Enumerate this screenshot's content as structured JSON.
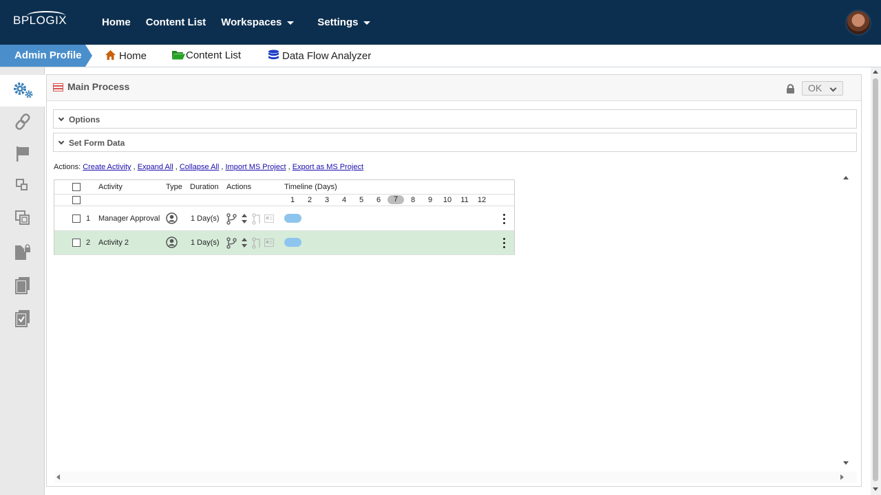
{
  "app": {
    "logo_text": "BPLOGIX"
  },
  "topnav": {
    "items": [
      {
        "label": "Home"
      },
      {
        "label": "Content List"
      },
      {
        "label": "Workspaces"
      },
      {
        "label": "Settings"
      }
    ]
  },
  "breadcrumb": {
    "admin": "Admin Profile",
    "items": [
      {
        "label": "Home",
        "icon": "house-icon"
      },
      {
        "label": "Content List",
        "icon": "folder-icon"
      },
      {
        "label": "Data Flow Analyzer",
        "icon": "database-icon"
      }
    ]
  },
  "sidebar": {
    "items": [
      {
        "icon": "gears-icon"
      },
      {
        "icon": "link-icon"
      },
      {
        "icon": "flag-icon"
      },
      {
        "icon": "layers-icon"
      },
      {
        "icon": "copy-icon"
      },
      {
        "icon": "locked-document-icon"
      },
      {
        "icon": "documents-icon"
      },
      {
        "icon": "checkbox-document-icon"
      }
    ]
  },
  "panel": {
    "title": "Main Process",
    "ok_label": "OK",
    "sections": [
      {
        "label": "Options"
      },
      {
        "label": "Set Form Data"
      }
    ],
    "actions_label": "Actions:",
    "actions": [
      {
        "label": "Create Activity"
      },
      {
        "label": "Expand All"
      },
      {
        "label": "Collapse All"
      },
      {
        "label": "Import MS Project"
      },
      {
        "label": "Export as MS Project"
      }
    ]
  },
  "grid": {
    "headers": {
      "activity": "Activity",
      "type": "Type",
      "duration": "Duration",
      "actions": "Actions",
      "timeline": "Timeline (Days)"
    },
    "days": [
      "1",
      "2",
      "3",
      "4",
      "5",
      "6",
      "7",
      "8",
      "9",
      "10",
      "11",
      "12"
    ],
    "today_index": 6,
    "rows": [
      {
        "num": "1",
        "activity": "Manager Approval",
        "duration": "1 Day(s)",
        "selected": false
      },
      {
        "num": "2",
        "activity": "Activity 2",
        "duration": "1 Day(s)",
        "selected": true
      }
    ]
  },
  "colors": {
    "topbar": "#0d2f4f",
    "breadcrumb_active": "#4a8fcb",
    "selected_row": "#d6ecd9",
    "timeline_bar": "#8ec5ee",
    "link": "#1a0dab"
  }
}
